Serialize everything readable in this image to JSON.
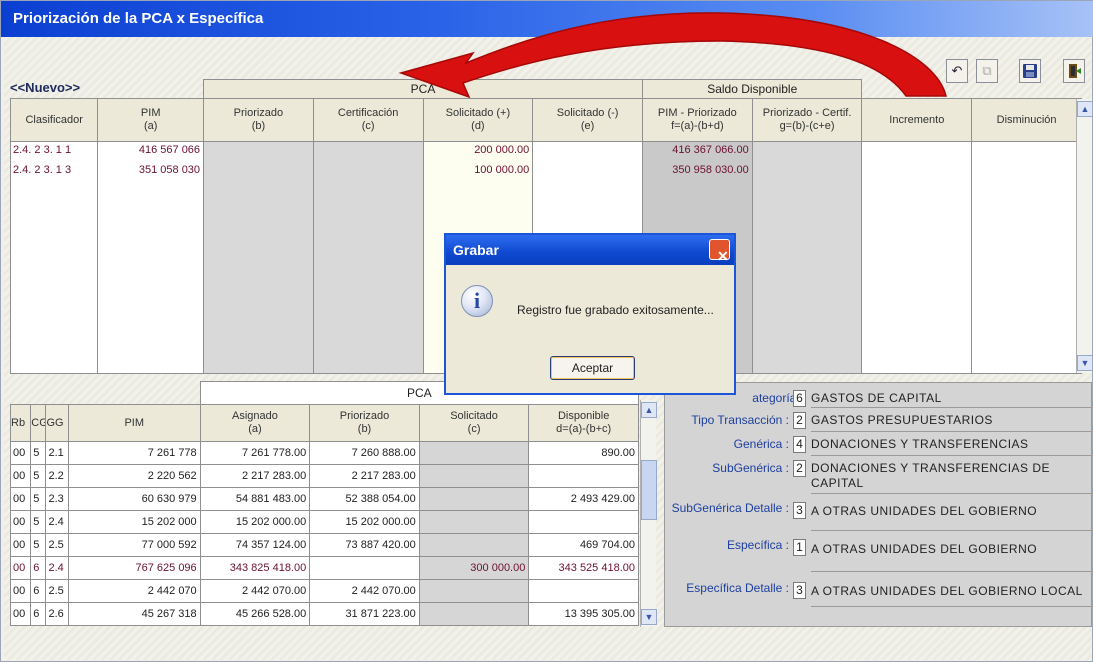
{
  "window": {
    "title": "Priorización de la PCA x Específica"
  },
  "toolbar": {
    "new_link": "<<Nuevo>>"
  },
  "colors": {
    "title_bar": "#2a63e8",
    "arrow": "#d81010",
    "code_text": "#6b1133",
    "form_label": "#1c3fa0"
  },
  "top_table": {
    "group_pca": "PCA",
    "group_saldo": "Saldo Disponible",
    "headers": [
      {
        "line1": "Clasificador",
        "line2": ""
      },
      {
        "line1": "PIM",
        "line2": "(a)"
      },
      {
        "line1": "Priorizado",
        "line2": "(b)"
      },
      {
        "line1": "Certificación",
        "line2": "(c)"
      },
      {
        "line1": "Solicitado (+)",
        "line2": "(d)"
      },
      {
        "line1": "Solicitado (-)",
        "line2": "(e)"
      },
      {
        "line1": "PIM - Priorizado",
        "line2": "f=(a)-(b+d)"
      },
      {
        "line1": "Priorizado - Certif.",
        "line2": "g=(b)-(c+e)"
      },
      {
        "line1": "Incremento",
        "line2": ""
      },
      {
        "line1": "Disminución",
        "line2": ""
      }
    ],
    "rows": [
      {
        "clasificador": "2.4. 2  3. 1  1",
        "pim": "416 567 066",
        "solicitado_plus": "200 000.00",
        "pim_priorizado": "416 367 066.00"
      },
      {
        "clasificador": "2.4. 2  3. 1  3",
        "pim": "351 058 030",
        "solicitado_plus": "100 000.00",
        "pim_priorizado": "350 958 030.00"
      }
    ]
  },
  "bottom_table": {
    "group_pca": "PCA",
    "headers": [
      {
        "line1": "Rb",
        "line2": ""
      },
      {
        "line1": "CG",
        "line2": ""
      },
      {
        "line1": "GG",
        "line2": ""
      },
      {
        "line1": "PIM",
        "line2": ""
      },
      {
        "line1": "Asignado",
        "line2": "(a)"
      },
      {
        "line1": "Priorizado",
        "line2": "(b)"
      },
      {
        "line1": "Solicitado",
        "line2": "(c)"
      },
      {
        "line1": "Disponible",
        "line2": "d=(a)-(b+c)"
      }
    ],
    "rows": [
      {
        "rb": "00",
        "cg": "5",
        "gg": "2.1",
        "pim": "7 261 778",
        "asignado": "7 261 778.00",
        "priorizado": "7 260 888.00",
        "solicitado": "",
        "disponible": "890.00"
      },
      {
        "rb": "00",
        "cg": "5",
        "gg": "2.2",
        "pim": "2 220 562",
        "asignado": "2 217 283.00",
        "priorizado": "2 217 283.00",
        "solicitado": "",
        "disponible": ""
      },
      {
        "rb": "00",
        "cg": "5",
        "gg": "2.3",
        "pim": "60 630 979",
        "asignado": "54 881 483.00",
        "priorizado": "52 388 054.00",
        "solicitado": "",
        "disponible": "2 493 429.00"
      },
      {
        "rb": "00",
        "cg": "5",
        "gg": "2.4",
        "pim": "15 202 000",
        "asignado": "15 202 000.00",
        "priorizado": "15 202 000.00",
        "solicitado": "",
        "disponible": ""
      },
      {
        "rb": "00",
        "cg": "5",
        "gg": "2.5",
        "pim": "77 000 592",
        "asignado": "74 357 124.00",
        "priorizado": "73 887 420.00",
        "solicitado": "",
        "disponible": "469 704.00"
      },
      {
        "rb": "00",
        "cg": "6",
        "gg": "2.4",
        "pim": "767 625 096",
        "asignado": "343 825 418.00",
        "priorizado": "",
        "solicitado": "300 000.00",
        "disponible": "343 525 418.00"
      },
      {
        "rb": "00",
        "cg": "6",
        "gg": "2.5",
        "pim": "2 442 070",
        "asignado": "2 442 070.00",
        "priorizado": "2 442 070.00",
        "solicitado": "",
        "disponible": ""
      },
      {
        "rb": "00",
        "cg": "6",
        "gg": "2.6",
        "pim": "45 267 318",
        "asignado": "45 266 528.00",
        "priorizado": "31 871 223.00",
        "solicitado": "",
        "disponible": "13 395 305.00"
      }
    ]
  },
  "form": {
    "categoria": {
      "label": "ategoría :",
      "code": "6",
      "desc": "GASTOS DE CAPITAL"
    },
    "tipo_transaccion": {
      "label": "Tipo Transacción :",
      "code": "2",
      "desc": "GASTOS PRESUPUESTARIOS"
    },
    "generica": {
      "label": "Genérica :",
      "code": "4",
      "desc": "DONACIONES Y TRANSFERENCIAS"
    },
    "subgenerica": {
      "label": "SubGenérica :",
      "code": "2",
      "desc_line1": "DONACIONES Y TRANSFERENCIAS DE",
      "desc_line2": "CAPITAL"
    },
    "subgenerica_detalle": {
      "label": "SubGenérica Detalle :",
      "code": "3",
      "desc": "A OTRAS UNIDADES DEL GOBIERNO"
    },
    "especifica": {
      "label": "Específica :",
      "code": "1",
      "desc": "A OTRAS UNIDADES DEL GOBIERNO"
    },
    "especifica_detalle": {
      "label": "Específica Detalle :",
      "code": "3",
      "desc": "A OTRAS UNIDADES DEL GOBIERNO LOCAL"
    }
  },
  "dialog": {
    "title": "Grabar",
    "close_glyph": "✕",
    "icon_glyph": "i",
    "message": "Registro fue grabado exitosamente...",
    "button": "Aceptar"
  },
  "icons": [
    "undo-icon",
    "copy-icon",
    "save-icon",
    "exit-icon",
    "info-icon",
    "close-icon",
    "arrow-annotation"
  ]
}
